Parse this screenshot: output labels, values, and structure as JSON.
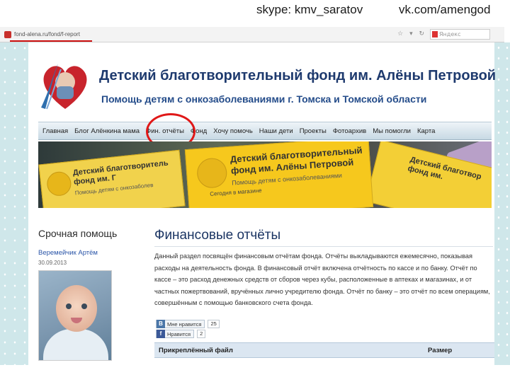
{
  "captions": {
    "skype": "skype: kmv_saratov",
    "vk": "vk.com/amengod"
  },
  "browser": {
    "url": "fond-alena.ru/fond/f-report",
    "search_placeholder": "Яндекс"
  },
  "site": {
    "title": "Детский благотворительный фонд им. Алёны Петровой",
    "subtitle": "Помощь детям с онкозаболеваниями г. Томска и Томской области"
  },
  "menu": [
    "Главная",
    "Блог Алёнкина мама",
    "Фин. отчёты",
    "Фонд",
    "Хочу помочь",
    "Наши дети",
    "Проекты",
    "Фотоархив",
    "Мы помогли",
    "Карта"
  ],
  "banner": {
    "card_title": "Детский благотворительный фонд им. Алёны Петровой",
    "card_title_short": "Детский благотворитель фонд им. Г",
    "card_sub": "Помощь детям с онкозаболев",
    "card_main_sub": "Помощь детям с онкозаболеваниями",
    "card_sub2": "Сегодня в магазине",
    "card_right": "Детский благотвор фонд им."
  },
  "sidebar": {
    "urgent_title": "Срочная помощь",
    "child_name": "Веремейчик Артём",
    "child_date": "30.09.2013"
  },
  "main": {
    "page_title": "Финансовые отчёты",
    "text": "Данный раздел посвящён финансовым отчётам фонда. Отчёты выкладываются ежемесячно, показывая расходы на деятельность фонда. В финансовый отчёт включена отчётность по кассе и по банку. Отчёт по кассе – это расход денежных средств от сборов через кубы, расположенные в аптеках и магазинах, и от частных пожертвований, вручённых лично учредителю фонда. Отчёт по банку – это отчёт по всем операциям, совершённым с помощью банковского счета фонда."
  },
  "share": {
    "vk_label": "Мне нравится",
    "vk_count": "25",
    "fb_label": "Нравится",
    "fb_count": "2"
  },
  "files_table": {
    "col_file": "Прикреплённый файл",
    "col_size": "Размер"
  }
}
